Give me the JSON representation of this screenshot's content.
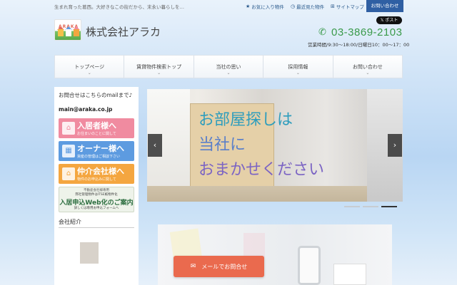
{
  "header": {
    "tagline": "生まれ育った葛西。大好きなこの街だから、末永い暮らしを…",
    "favorites": "お気に入り物件",
    "recent": "最近見た物件",
    "sitemap": "サイトマップ",
    "contact": "お問い合わせ",
    "logo_text": "ARAKA",
    "company": "株式会社アラカ",
    "tweet": "ポスト",
    "phone": "03-3869-2103",
    "hours": "営業時間/9:30〜18:00/日曜日10：00〜17：00"
  },
  "nav": {
    "items": [
      {
        "label": "トップページ"
      },
      {
        "label": "賃貸物件検索トップ"
      },
      {
        "label": "当社の思い"
      },
      {
        "label": "採用情報"
      },
      {
        "label": "お問い合わせ"
      }
    ]
  },
  "sidebar": {
    "message": "お問合せはこちらのmailまで♪",
    "email": "main@araka.co.jp",
    "banners": [
      {
        "title": "入居者様へ",
        "sub": "お住まいのことに関して"
      },
      {
        "title": "オーナー様へ",
        "sub": "資産の管理はご相談下さい"
      },
      {
        "title": "仲介会社様へ",
        "sub": "物件のお申込みに関して"
      }
    ],
    "web_banner": {
      "line1": "不動産会社様専用",
      "line2": "弊社管理物件はITSE紙物件化",
      "line3": "入居申込Web化のご案内",
      "line4": "詳しくは専用お申込フォームへ"
    },
    "section_title": "会社紹介"
  },
  "slider": {
    "line1": "お部屋探しは",
    "line2": "当社に",
    "line3": "おまかせください",
    "prev": "‹",
    "next": "›",
    "dots": 3,
    "active_dot": 3
  },
  "cta": {
    "label": "メールでお問合せ"
  }
}
